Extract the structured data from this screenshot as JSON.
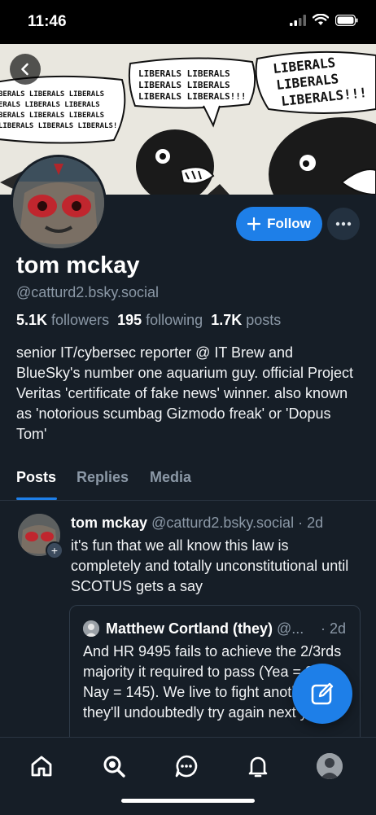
{
  "status_bar": {
    "time": "11:46"
  },
  "banner": {
    "left_bubble": [
      "BERALS LIBERALS LIBERALS",
      "ERALS LIBERALS LIBERALS",
      "BERALS LIBERALS LIBERALS",
      "LIBERALS LIBERALS LIBERALS!"
    ],
    "middle_bubble": [
      "LIBERALS LIBERALS",
      "LIBERALS LIBERALS",
      "LIBERALS LIBERALS!!!"
    ],
    "right_bubble": [
      "LIBERALS",
      "LIBERALS",
      "LIBERALS!!!"
    ]
  },
  "profile": {
    "name": "tom mckay",
    "handle": "@catturd2.bsky.social",
    "followers_count": "5.1K",
    "followers_label": "followers",
    "following_count": "195",
    "following_label": "following",
    "posts_count": "1.7K",
    "posts_label": "posts",
    "bio": "senior IT/cybersec reporter @ IT Brew and BlueSky's number one aquarium guy. official Project Veritas 'certificate of fake news' winner. also known as 'notorious scumbag Gizmodo freak' or 'Dopus Tom'",
    "follow_label": "Follow"
  },
  "tabs": [
    {
      "label": "Posts",
      "active": true
    },
    {
      "label": "Replies",
      "active": false
    },
    {
      "label": "Media",
      "active": false
    }
  ],
  "post": {
    "author": "tom mckay",
    "handle": "@catturd2.bsky.social",
    "time": "· 2d",
    "text": "it's fun that we all know this law is completely and totally unconstitutional until SCOTUS gets a say",
    "quote": {
      "author": "Matthew Cortland (they)",
      "handle": "@...",
      "time": "· 2d",
      "text": "And HR 9495 fails to achieve the 2/3rds majority it required to pass (Yea = 256, Nay = 145). We live to fight another day; they'll undoubtedly try again next year."
    }
  },
  "colors": {
    "accent": "#1e7fe8",
    "background": "#161e27",
    "muted_text": "#8b98a6"
  },
  "icons": [
    "back-arrow-icon",
    "plus-icon",
    "ellipsis-icon",
    "compose-icon",
    "home-icon",
    "search-icon",
    "chat-icon",
    "bell-icon"
  ]
}
